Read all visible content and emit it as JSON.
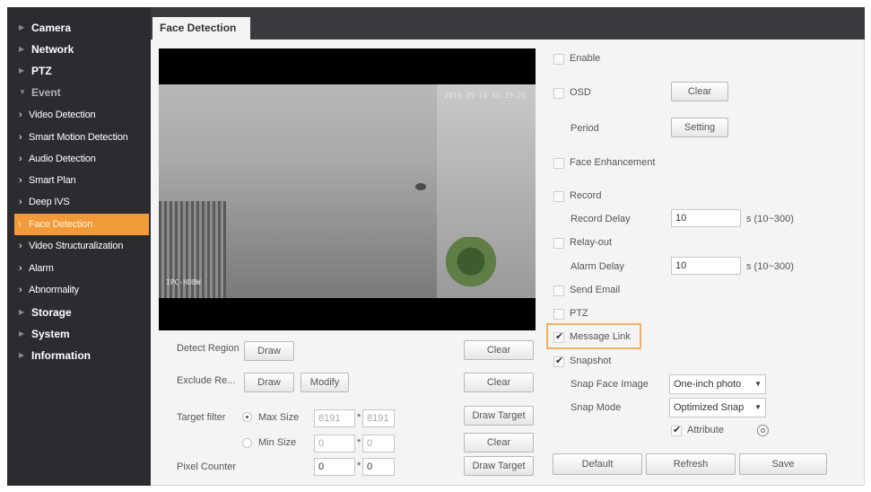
{
  "sidebar": {
    "items": [
      {
        "label": "Camera"
      },
      {
        "label": "Network"
      },
      {
        "label": "PTZ"
      },
      {
        "label": "Event"
      },
      {
        "label": "Video Detection"
      },
      {
        "label": "Smart Motion Detection"
      },
      {
        "label": "Audio Detection"
      },
      {
        "label": "Smart Plan"
      },
      {
        "label": "Deep IVS"
      },
      {
        "label": "Face Detection"
      },
      {
        "label": "Video Structuralization"
      },
      {
        "label": "Alarm"
      },
      {
        "label": "Abnormality"
      },
      {
        "label": "Storage"
      },
      {
        "label": "System"
      },
      {
        "label": "Information"
      }
    ],
    "active": "Face Detection"
  },
  "tab": {
    "label": "Face Detection"
  },
  "video": {
    "osd_time": "2019-05-14 15:39:25",
    "osd_channel": "IPC-HDBW"
  },
  "left_panel": {
    "detect_region": {
      "label": "Detect Region",
      "draw": "Draw",
      "clear": "Clear"
    },
    "exclude_region": {
      "label": "Exclude Re...",
      "draw": "Draw",
      "modify": "Modify",
      "clear": "Clear"
    },
    "target_filter": {
      "label": "Target filter",
      "max_size": {
        "label": "Max Size",
        "w": "8191",
        "h": "8191",
        "selected": true
      },
      "min_size": {
        "label": "Min Size",
        "w": "0",
        "h": "0",
        "selected": false
      },
      "draw_target": "Draw Target",
      "clear": "Clear"
    },
    "pixel_counter": {
      "label": "Pixel Counter",
      "w": "0",
      "h": "0",
      "draw_target": "Draw Target"
    },
    "separator": "*"
  },
  "right_panel": {
    "enable": {
      "label": "Enable",
      "checked": false
    },
    "osd": {
      "label": "OSD",
      "checked": false,
      "clear": "Clear"
    },
    "period": {
      "label": "Period",
      "setting": "Setting"
    },
    "face_enhancement": {
      "label": "Face Enhancement",
      "checked": false
    },
    "record": {
      "label": "Record",
      "checked": false
    },
    "record_delay": {
      "label": "Record Delay",
      "value": "10",
      "range": "s (10~300)"
    },
    "relay_out": {
      "label": "Relay-out",
      "checked": false
    },
    "alarm_delay": {
      "label": "Alarm Delay",
      "value": "10",
      "range": "s (10~300)"
    },
    "send_email": {
      "label": "Send Email",
      "checked": false
    },
    "ptz": {
      "label": "PTZ",
      "checked": false
    },
    "message_link": {
      "label": "Message Link",
      "checked": true
    },
    "snapshot": {
      "label": "Snapshot",
      "checked": true
    },
    "snap_face_image": {
      "label": "Snap Face Image",
      "value": "One-inch photo"
    },
    "snap_mode": {
      "label": "Snap Mode",
      "value": "Optimized Snap"
    },
    "attribute": {
      "label": "Attribute",
      "checked": true
    }
  },
  "footer": {
    "default": "Default",
    "refresh": "Refresh",
    "save": "Save"
  },
  "colors": {
    "accent": "#f29a38",
    "sidebar_bg": "#2a2c30",
    "highlight": "#f0b060"
  }
}
